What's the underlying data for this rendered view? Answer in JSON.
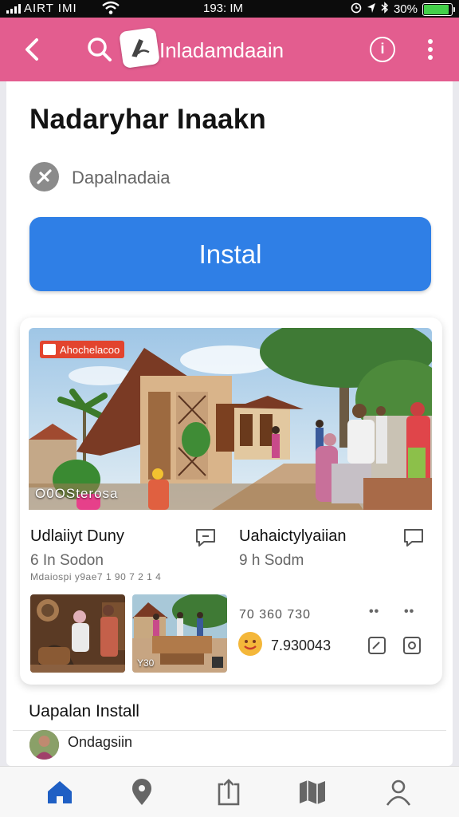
{
  "status_bar": {
    "carrier": "AIRT IMI",
    "time": "193: IM",
    "battery_text": "30%",
    "battery_level": 0.9
  },
  "app_bar": {
    "title": "Inladamdaain",
    "icons": [
      "back-arrow-icon",
      "search-icon",
      "app-logo-icon",
      "info-icon",
      "more-vert-icon"
    ]
  },
  "app": {
    "name": "Nadaryhar Inaakn",
    "developer": "Dapalnadaia",
    "install_label": "Instal"
  },
  "card": {
    "hero_badge": "Ahochelacoo",
    "hero_caption": "O0OSterosa",
    "left": {
      "title": "Udlaiiyt Duny",
      "sub": "6 In Sodon",
      "meta": "Mdaiospi y9ae7 1 90 7 2 1 4",
      "thumb2_label": "Y30"
    },
    "right": {
      "title": "Uahaictylyaiian",
      "sub": "9 h Sodm",
      "stats": "70  360  730",
      "rating": "7.930043"
    }
  },
  "install_section": {
    "title": "Uapalan Install",
    "reviewer": "Ondagsiin"
  },
  "bottom_nav": [
    "home-icon",
    "location-icon",
    "share-icon",
    "map-icon",
    "profile-icon"
  ],
  "colors": {
    "app_bar": "#e35d8f",
    "install_button": "#2f7fe6",
    "badge": "#e2442e"
  }
}
